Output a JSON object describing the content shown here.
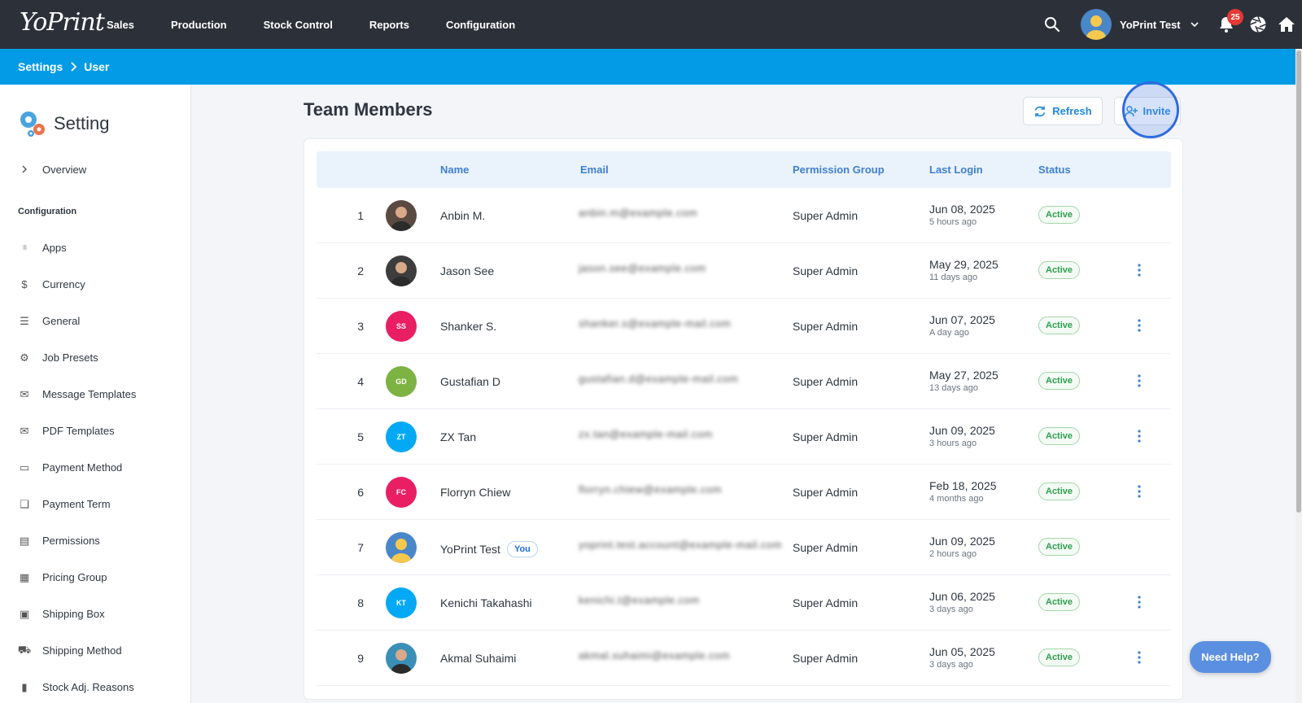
{
  "app": {
    "logo": "YoPrint"
  },
  "nav": {
    "items": [
      "Sales",
      "Production",
      "Stock Control",
      "Reports",
      "Configuration"
    ]
  },
  "user": {
    "name": "YoPrint Test",
    "notifications": "25"
  },
  "breadcrumb": {
    "items": [
      "Settings",
      "User"
    ]
  },
  "sidebar": {
    "title": "Setting",
    "overview": "Overview",
    "section": "Configuration",
    "items": [
      {
        "label": "Apps",
        "icon": "grid-icon"
      },
      {
        "label": "Currency",
        "icon": "dollar-icon"
      },
      {
        "label": "General",
        "icon": "sliders-icon"
      },
      {
        "label": "Job Presets",
        "icon": "gear-icon"
      },
      {
        "label": "Message Templates",
        "icon": "mail-icon"
      },
      {
        "label": "PDF Templates",
        "icon": "mail-icon"
      },
      {
        "label": "Payment Method",
        "icon": "card-icon"
      },
      {
        "label": "Payment Term",
        "icon": "clipboard-icon"
      },
      {
        "label": "Permissions",
        "icon": "clipboard-list-icon"
      },
      {
        "label": "Pricing Group",
        "icon": "calendar-icon"
      },
      {
        "label": "Shipping Box",
        "icon": "archive-icon"
      },
      {
        "label": "Shipping Method",
        "icon": "truck-icon"
      },
      {
        "label": "Stock Adj. Reasons",
        "icon": "comment-icon"
      }
    ]
  },
  "main": {
    "title": "Team Members",
    "refresh_label": "Refresh",
    "invite_label": "Invite",
    "columns": {
      "name": "Name",
      "email": "Email",
      "permission": "Permission Group",
      "last_login": "Last Login",
      "status": "Status"
    },
    "you_label": "You",
    "rows": [
      {
        "num": "1",
        "name": "Anbin M.",
        "email": "anbin.m@example.com",
        "permission": "Super Admin",
        "date": "Jun 08, 2025",
        "ago": "5 hours ago",
        "status": "Active",
        "initials": "",
        "color": "#5a4a42",
        "menu": false
      },
      {
        "num": "2",
        "name": "Jason See",
        "email": "jason.see@example.com",
        "permission": "Super Admin",
        "date": "May 29, 2025",
        "ago": "11 days ago",
        "status": "Active",
        "initials": "",
        "color": "#3d3d3d",
        "menu": true
      },
      {
        "num": "3",
        "name": "Shanker S.",
        "email": "shanker.s@example-mail.com",
        "permission": "Super Admin",
        "date": "Jun 07, 2025",
        "ago": "A day ago",
        "status": "Active",
        "initials": "SS",
        "color": "#e91e63",
        "menu": true
      },
      {
        "num": "4",
        "name": "Gustafian D",
        "email": "gustafian.d@example-mail.com",
        "permission": "Super Admin",
        "date": "May 27, 2025",
        "ago": "13 days ago",
        "status": "Active",
        "initials": "GD",
        "color": "#7cb342",
        "menu": true
      },
      {
        "num": "5",
        "name": "ZX Tan",
        "email": "zx.tan@example-mail.com",
        "permission": "Super Admin",
        "date": "Jun 09, 2025",
        "ago": "3 hours ago",
        "status": "Active",
        "initials": "ZT",
        "color": "#03a9f4",
        "menu": true
      },
      {
        "num": "6",
        "name": "Florryn Chiew",
        "email": "florryn.chiew@example.com",
        "permission": "Super Admin",
        "date": "Feb 18, 2025",
        "ago": "4 months ago",
        "status": "Active",
        "initials": "FC",
        "color": "#e91e63",
        "menu": true
      },
      {
        "num": "7",
        "name": "YoPrint Test",
        "email": "yoprint.test.account@example-mail.com",
        "permission": "Super Admin",
        "date": "Jun 09, 2025",
        "ago": "2 hours ago",
        "status": "Active",
        "initials": "",
        "color": "#4a87c9",
        "menu": false,
        "you": true
      },
      {
        "num": "8",
        "name": "Kenichi Takahashi",
        "email": "kenichi.t@example.com",
        "permission": "Super Admin",
        "date": "Jun 06, 2025",
        "ago": "3 days ago",
        "status": "Active",
        "initials": "KT",
        "color": "#03a9f4",
        "menu": true
      },
      {
        "num": "9",
        "name": "Akmal Suhaimi",
        "email": "akmal.suhaimi@example.com",
        "permission": "Super Admin",
        "date": "Jun 05, 2025",
        "ago": "3 days ago",
        "status": "Active",
        "initials": "",
        "color": "#3a8fb7",
        "menu": true
      }
    ]
  },
  "help": {
    "label": "Need Help?"
  }
}
